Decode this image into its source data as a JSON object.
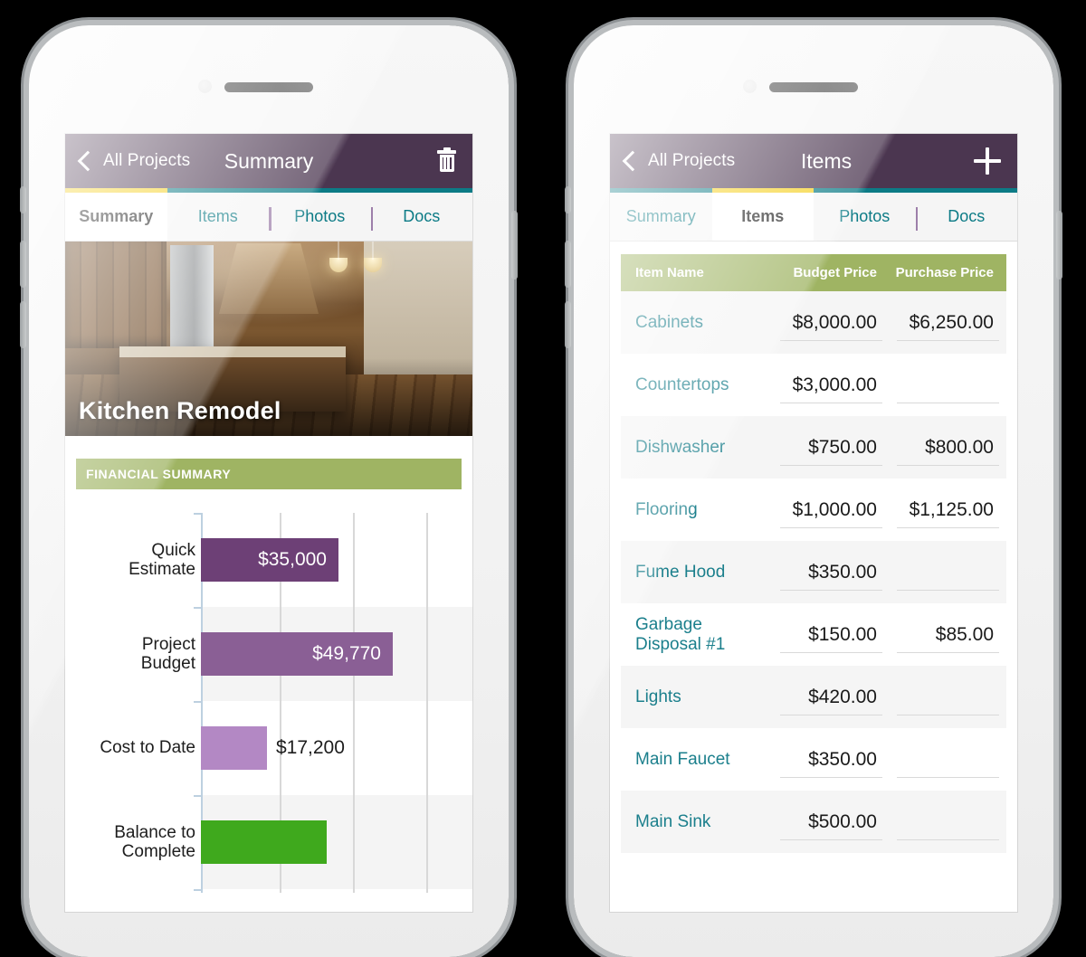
{
  "left_phone": {
    "navbar": {
      "back_label": "All Projects",
      "title": "Summary",
      "action_icon": "trash-icon"
    },
    "tabs": [
      {
        "label": "Summary",
        "active": true
      },
      {
        "label": "Items",
        "active": false
      },
      {
        "label": "Photos",
        "active": false
      },
      {
        "label": "Docs",
        "active": false
      }
    ],
    "hero": {
      "project_title": "Kitchen Remodel"
    },
    "section_header": "FINANCIAL SUMMARY",
    "chart_data": {
      "type": "bar",
      "orientation": "horizontal",
      "title": "FINANCIAL SUMMARY",
      "categories": [
        "Quick\nEstimate",
        "Project\nBudget",
        "Cost to Date",
        "Balance to\nComplete"
      ],
      "values": [
        35000,
        49770,
        17200,
        32570
      ],
      "labels": [
        "$35,000",
        "$49,770",
        "$17,200",
        ""
      ],
      "colors": [
        "#6d4076",
        "#8a5f95",
        "#b388c4",
        "#3fa91d"
      ],
      "label_inside": [
        true,
        true,
        false,
        false
      ],
      "xlim": [
        0,
        60000
      ],
      "gridlines": [
        15000,
        30000,
        45000,
        60000
      ],
      "xlabel": "",
      "ylabel": "",
      "grid": true,
      "legend": false
    }
  },
  "right_phone": {
    "navbar": {
      "back_label": "All Projects",
      "title": "Items",
      "action_icon": "plus-icon"
    },
    "tabs": [
      {
        "label": "Summary",
        "active": false
      },
      {
        "label": "Items",
        "active": true
      },
      {
        "label": "Photos",
        "active": false
      },
      {
        "label": "Docs",
        "active": false
      }
    ],
    "table": {
      "columns": [
        "Item Name",
        "Budget Price",
        "Purchase Price"
      ],
      "rows": [
        {
          "name": "Cabinets",
          "budget": "$8,000.00",
          "purchase": "$6,250.00"
        },
        {
          "name": "Countertops",
          "budget": "$3,000.00",
          "purchase": ""
        },
        {
          "name": "Dishwasher",
          "budget": "$750.00",
          "purchase": "$800.00"
        },
        {
          "name": "Flooring",
          "budget": "$1,000.00",
          "purchase": "$1,125.00"
        },
        {
          "name": "Fume Hood",
          "budget": "$350.00",
          "purchase": ""
        },
        {
          "name": "Garbage\nDisposal #1",
          "budget": "$150.00",
          "purchase": "$85.00"
        },
        {
          "name": "Lights",
          "budget": "$420.00",
          "purchase": ""
        },
        {
          "name": "Main Faucet",
          "budget": "$350.00",
          "purchase": ""
        },
        {
          "name": "Main Sink",
          "budget": "$500.00",
          "purchase": ""
        }
      ]
    }
  },
  "colors": {
    "nav_purple": "#4b3650",
    "tab_teal": "#0c7b86",
    "tab_active_underline": "#f5d022",
    "band_green": "#9fb463",
    "link_teal": "#1b7f8c",
    "bar_dark_purple": "#6d4076",
    "bar_mid_purple": "#8a5f95",
    "bar_light_purple": "#b388c4",
    "bar_green": "#3fa91d"
  }
}
